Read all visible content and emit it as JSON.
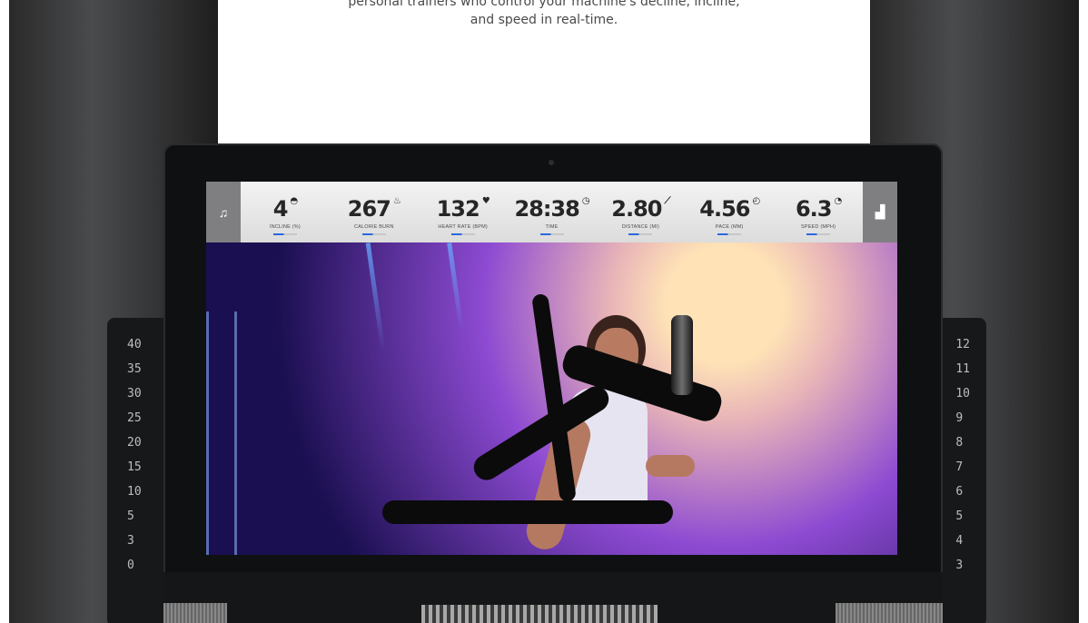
{
  "caption": {
    "line1": "personal trainers who control your machine's decline, incline,",
    "line2": "and speed in real-time."
  },
  "stats": [
    {
      "value": "4",
      "label": "INCLINE (%)",
      "icon": "incline-icon"
    },
    {
      "value": "267",
      "label": "CALORIE BURN",
      "icon": "flame-icon"
    },
    {
      "value": "132",
      "label": "HEART RATE (BPM)",
      "icon": "heart-icon"
    },
    {
      "value": "28:38",
      "label": "TIME",
      "icon": "timer-icon"
    },
    {
      "value": "2.80",
      "label": "DISTANCE (MI)",
      "icon": "distance-icon"
    },
    {
      "value": "4.56",
      "label": "PACE (MM)",
      "icon": "pace-icon"
    },
    {
      "value": "6.3",
      "label": "SPEED (MPH)",
      "icon": "speedometer-icon"
    }
  ],
  "icons": {
    "left": "music-note-icon",
    "right": "chart-icon"
  },
  "left_scale": [
    "40",
    "35",
    "30",
    "25",
    "20",
    "15",
    "10",
    "5",
    "3",
    "0"
  ],
  "right_scale": [
    "12",
    "11",
    "10",
    "9",
    "8",
    "7",
    "6",
    "5",
    "4",
    "3"
  ]
}
